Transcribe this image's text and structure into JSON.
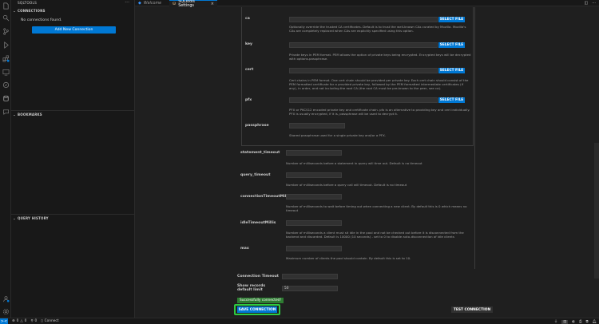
{
  "sidebar": {
    "title": "SQLTOOLS",
    "more": "···",
    "connections": {
      "header": "CONNECTIONS",
      "empty_text": "No connections found.",
      "add_button": "Add New Connection"
    },
    "bookmarks": {
      "header": "BOOKMARKS"
    },
    "history": {
      "header": "QUERY HISTORY"
    }
  },
  "tabs": [
    {
      "label": "Welcome",
      "icon": "vscode-logo-icon"
    },
    {
      "label": "SQLTools Settings",
      "icon": "sqltools-icon",
      "close": "×"
    }
  ],
  "form": {
    "ssl": {
      "ca": {
        "label": "ca",
        "button": "SELECT FILE",
        "description": "Optionally override the trusted CA certificates. Default is to trust the well-known CAs curated by Mozilla. Mozilla's CAs are completely replaced when CAs are explicitly specified using this option."
      },
      "key": {
        "label": "key",
        "button": "SELECT FILE",
        "description": "Private keys in PEM format. PEM allows the option of private keys being encrypted. Encrypted keys will be decrypted with options.passphrase."
      },
      "cert": {
        "label": "cert",
        "button": "SELECT FILE",
        "description": "Cert chains in PEM format. One cert chain should be provided per private key. Each cert chain should consist of the PEM formatted certificate for a provided private key, followed by the PEM formatted intermediate certificates (if any), in order, and not including the root CA (the root CA must be pre-known to the peer, see ca)."
      },
      "pfx": {
        "label": "pfx",
        "button": "SELECT FILE",
        "description": "PFX or PKCS12 encoded private key and certificate chain. pfx is an alternative to providing key and cert individually. PFX is usually encrypted, if it is, passphrase will be used to decrypt it."
      },
      "passphrase": {
        "label": "passphrase",
        "description": "Shared passphrase used for a single private key and/or a PFX."
      }
    },
    "statement_timeout": {
      "label": "statement_timeout",
      "description": "Number of milliseconds before a statement in query will time out. Default is no timeout"
    },
    "query_timeout": {
      "label": "query_timeout",
      "description": "Number of milliseconds before a query call will timeout. Default is no timeout"
    },
    "connectionTimeoutMillis": {
      "label": "connectionTimeoutMillis",
      "description": "Number of milliseconds to wait before timing out when connecting a new client. By default this is 0 which means no timeout"
    },
    "idleTimeoutMillis": {
      "label": "idleTimeoutMillis",
      "description": "Number of milliseconds a client must sit idle in the pool and not be checked out before it is disconnected from the backend and discarded. Default is 10000 (10 seconds) - set to 0 to disable auto-disconnection of idle clients"
    },
    "max": {
      "label": "max",
      "description": "Maximum number of clients the pool should contain. By default this is set to 10."
    },
    "connection_timeout": {
      "label": "Connection Timeout",
      "value": ""
    },
    "show_records": {
      "label": "Show records default limit",
      "value": "50"
    },
    "success_message": "Successfully connected!",
    "save_button": "SAVE CONNECTION",
    "test_button": "TEST CONNECTION"
  },
  "statusbar": {
    "remote": "><",
    "errors": "0",
    "warnings": "0",
    "ports": "0",
    "connect": "Connect"
  }
}
